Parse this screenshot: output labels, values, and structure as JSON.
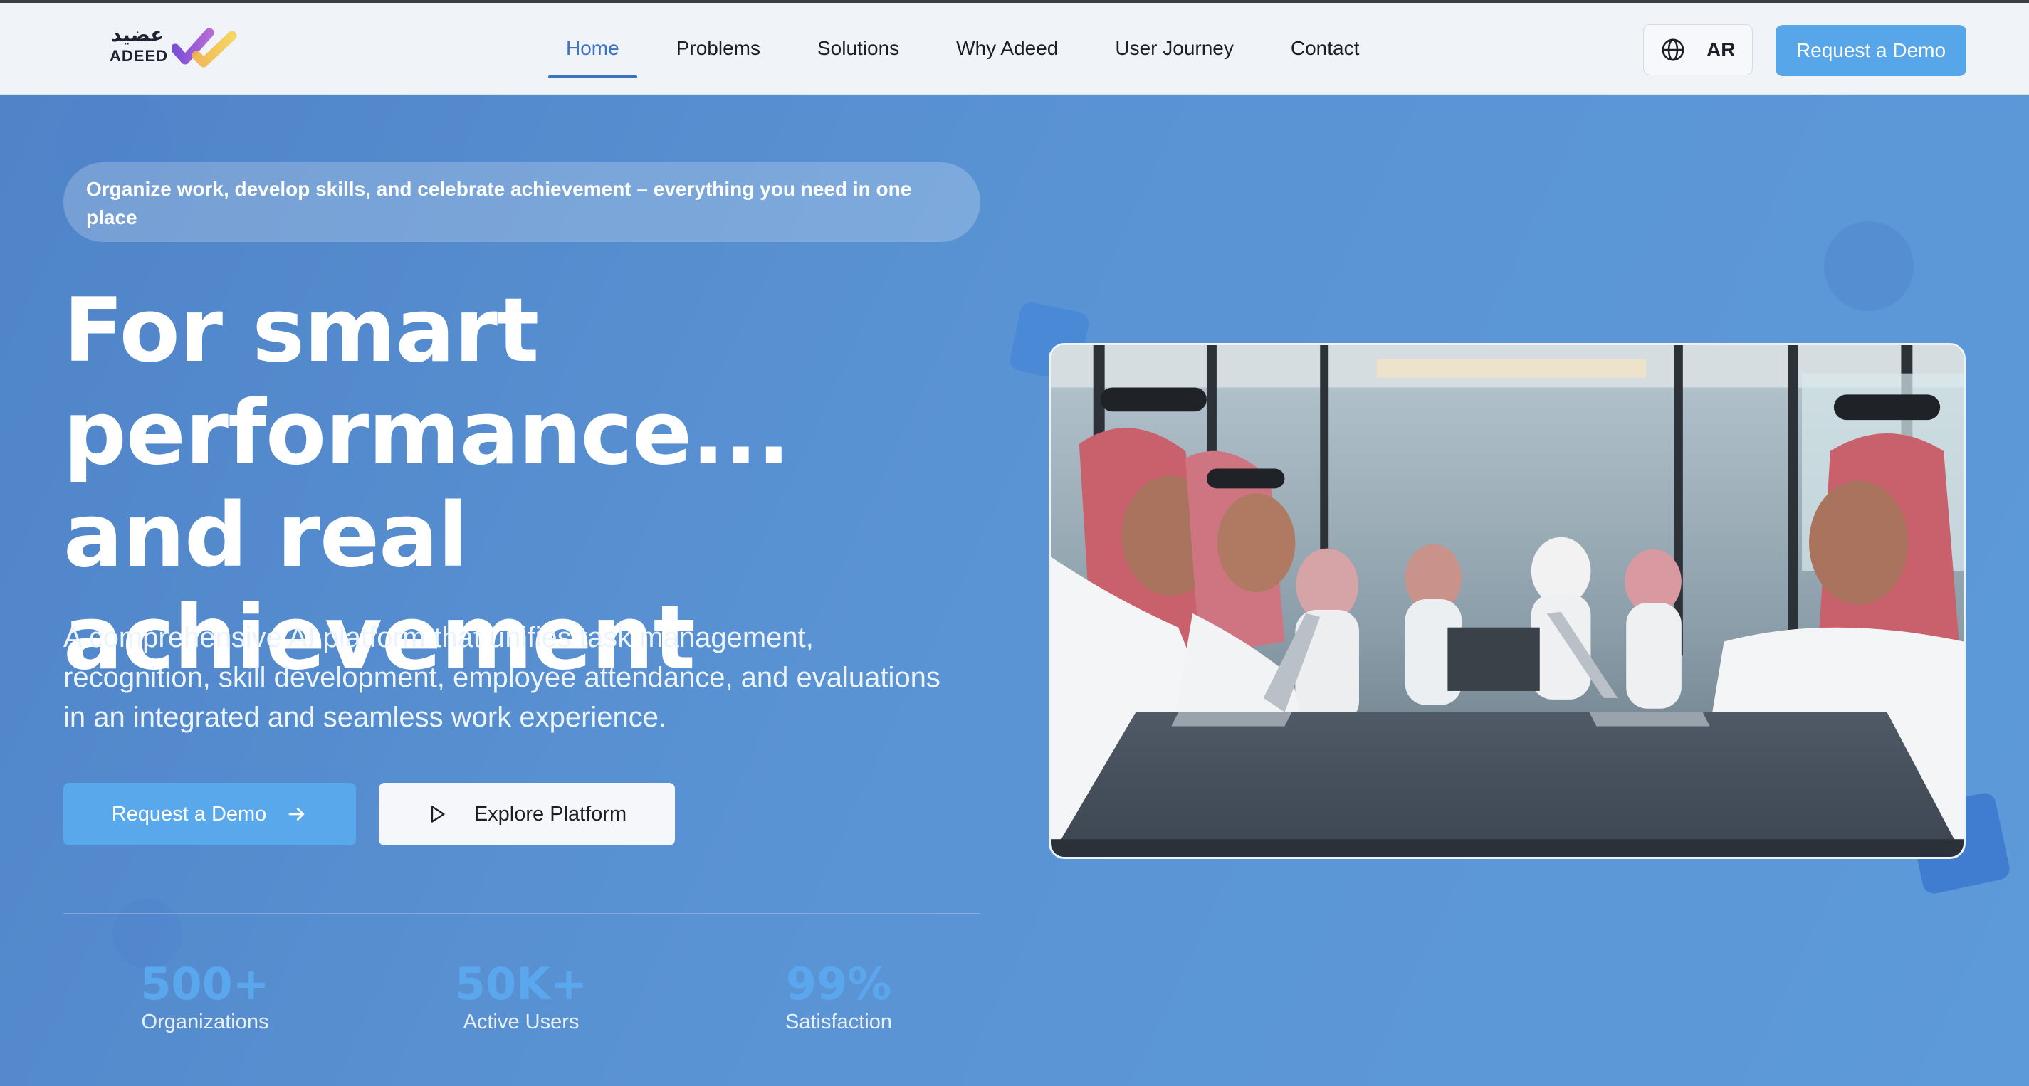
{
  "header": {
    "logo_ar": "عضيد",
    "logo_en": "ADEED",
    "nav": [
      {
        "label": "Home",
        "active": true
      },
      {
        "label": "Problems"
      },
      {
        "label": "Solutions"
      },
      {
        "label": "Why Adeed"
      },
      {
        "label": "User Journey"
      },
      {
        "label": "Contact"
      }
    ],
    "language_label": "AR",
    "language_icon": "globe-icon",
    "demo_button": "Request a Demo"
  },
  "hero": {
    "tagline": "Organize work, develop skills, and celebrate achievement – everything you need in one place",
    "headline": "For smart performance... and real achievement",
    "description": "A comprehensive AI platform that unifies task management, recognition, skill development, employee attendance, and evaluations in an integrated and seamless work experience.",
    "primary_button": "Request a Demo",
    "primary_button_icon": "arrow-right-icon",
    "secondary_button": "Explore Platform",
    "secondary_button_icon": "play-icon",
    "image_subject": "meeting-photo"
  },
  "stats": [
    {
      "value": "500+",
      "label": "Organizations"
    },
    {
      "value": "50K+",
      "label": "Active Users"
    },
    {
      "value": "99%",
      "label": "Satisfaction"
    }
  ],
  "colors": {
    "accent": "#58a6ea",
    "nav_active": "#3b73c2",
    "hero_bg": "#5a93d4",
    "stat_value": "#5aa7ee"
  }
}
